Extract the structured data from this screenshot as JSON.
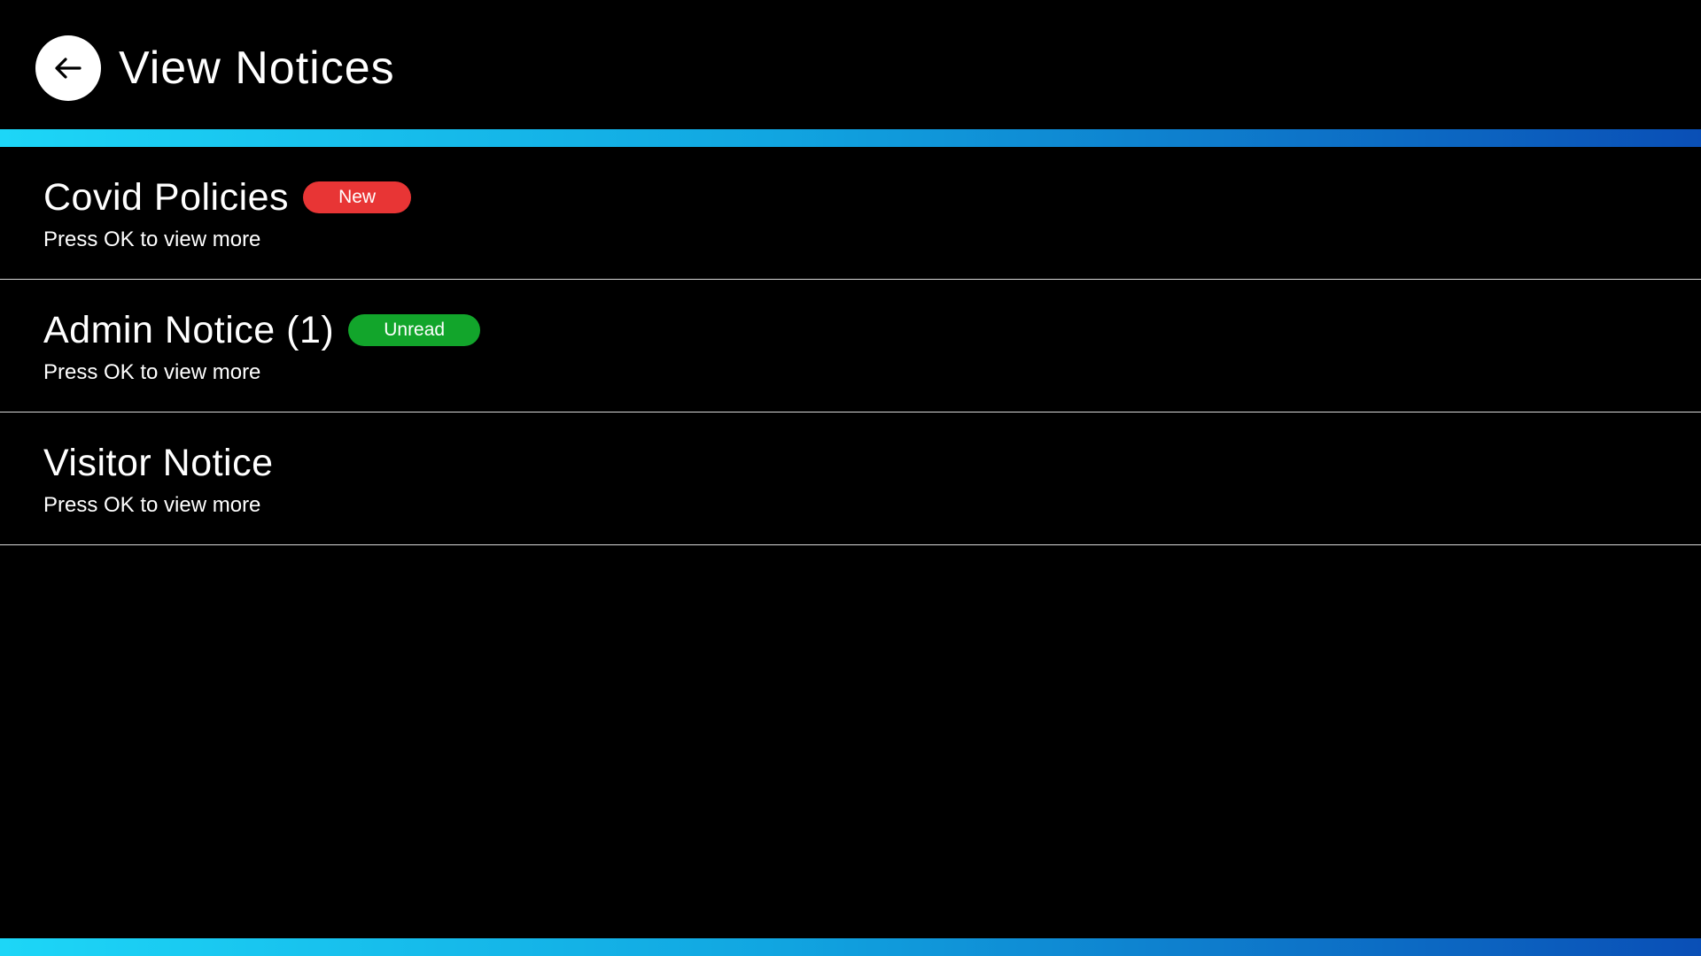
{
  "header": {
    "title": "View Notices",
    "back_icon": "arrow-left-icon"
  },
  "colors": {
    "background": "#000000",
    "gradient_start": "#1dd6f7",
    "gradient_end": "#0a4fb6",
    "badge_new": "#e83535",
    "badge_unread": "#12a52b"
  },
  "notices": [
    {
      "title": "Covid Policies",
      "badge": "New",
      "badge_color": "#e83535",
      "subtitle": "Press OK to view more"
    },
    {
      "title": "Admin Notice (1)",
      "badge": "Unread",
      "badge_color": "#12a52b",
      "subtitle": "Press OK to view more"
    },
    {
      "title": "Visitor Notice",
      "badge": "",
      "badge_color": "",
      "subtitle": "Press OK to view more"
    }
  ]
}
